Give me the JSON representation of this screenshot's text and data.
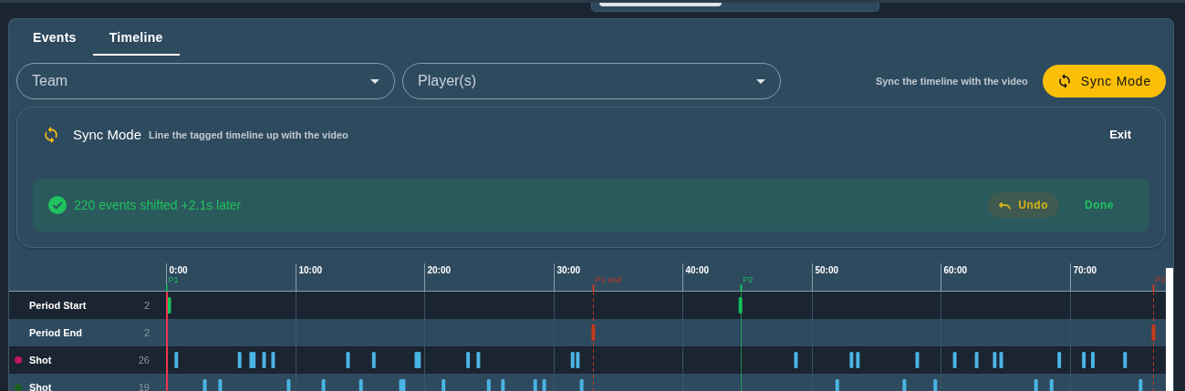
{
  "tabs": [
    {
      "label": "Events",
      "selected": false
    },
    {
      "label": "Timeline",
      "selected": true
    }
  ],
  "filters": [
    {
      "placeholder": "Team"
    },
    {
      "placeholder": "Player(s)"
    }
  ],
  "sync_hint": "Sync the timeline with the video",
  "sync_button": "Sync Mode",
  "sync_panel": {
    "title": "Sync Mode",
    "subtitle": "Line the tagged timeline up with the video",
    "exit": "Exit",
    "alert": {
      "message": "220 events shifted +2.1s later",
      "undo": "Undo",
      "done": "Done"
    }
  },
  "timeline": {
    "rows": [
      {
        "label": "Period Start",
        "count": "2"
      },
      {
        "label": "Period End",
        "count": "2"
      },
      {
        "label": "Shot",
        "count": "26",
        "color": "#c2185b"
      },
      {
        "label": "Shot",
        "count": "19",
        "color": "#1b5e20"
      }
    ],
    "time_labels": [
      "0:00",
      "10:00",
      "20:00",
      "30:00",
      "40:00",
      "50:00",
      "60:00",
      "70:00"
    ],
    "period_markers": [
      {
        "label": "P1",
        "kind": "start"
      },
      {
        "label": "P1 end",
        "kind": "end"
      },
      {
        "label": "P2",
        "kind": "start"
      },
      {
        "label": "P2",
        "kind": "end"
      }
    ]
  }
}
